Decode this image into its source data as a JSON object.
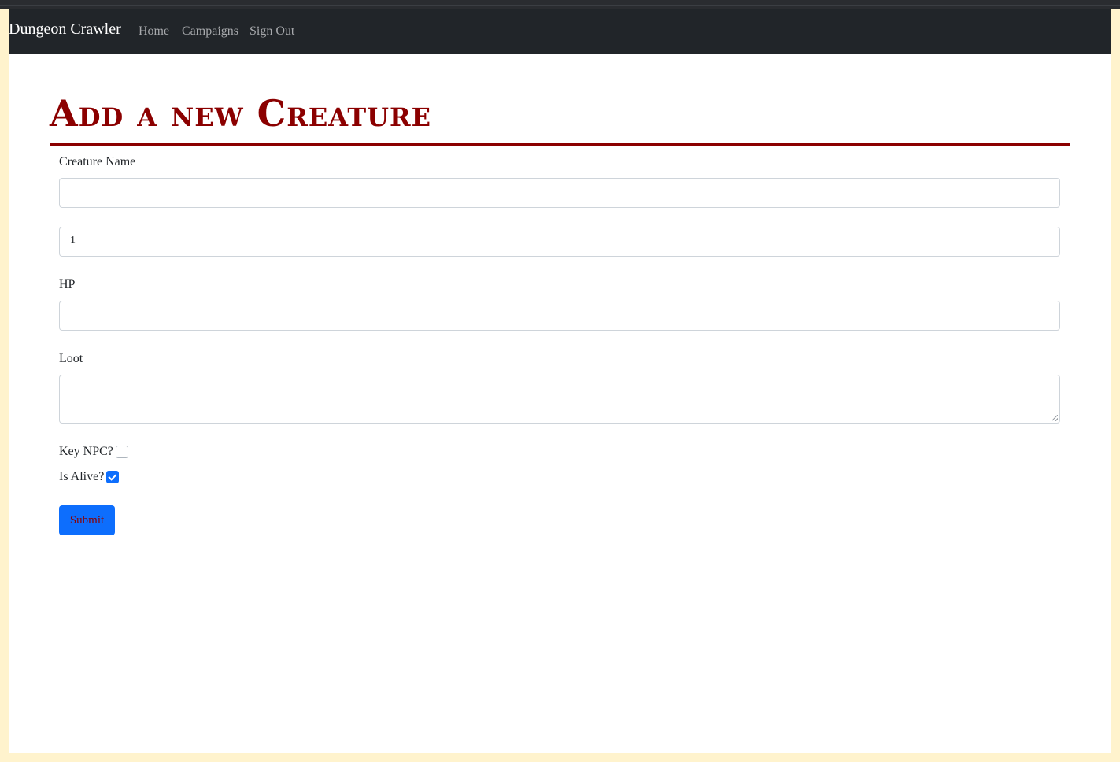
{
  "navbar": {
    "brand": "Dungeon Crawler",
    "links": [
      "Home",
      "Campaigns",
      "Sign Out"
    ]
  },
  "page": {
    "title": "Add a new Creature"
  },
  "form": {
    "creature_name_label": "Creature Name",
    "creature_name_value": "",
    "second_field_value": "1",
    "hp_label": "HP",
    "hp_value": "",
    "loot_label": "Loot",
    "loot_value": "",
    "key_npc_label": "Key NPC?",
    "key_npc_checked": false,
    "is_alive_label": "Is Alive?",
    "is_alive_checked": true,
    "submit_label": "Submit"
  },
  "colors": {
    "navbar_bg": "#212529",
    "title": "#8b0000",
    "primary": "#0d6efd",
    "outer_bg": "#fff3cd"
  }
}
